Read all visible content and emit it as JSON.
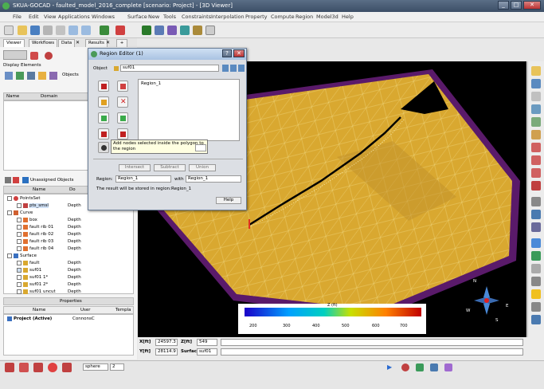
{
  "window": {
    "title": "SKUA-GOCAD - faulted_model_2016_complete  [scenario: Project]  - [3D Viewer]"
  },
  "menu": [
    "File",
    "Edit",
    "View",
    "Applications",
    "Windows",
    "Surface",
    "New",
    "Tools",
    "Constraints",
    "Interpolation",
    "Property",
    "Compute",
    "Region",
    "Model3d",
    "Help"
  ],
  "tabs": [
    "Viewer",
    "Workflows",
    "Data",
    "Results"
  ],
  "display_elements": {
    "label": "Display Elements",
    "objects_label": "Objects",
    "columns": [
      "Name",
      "Domain"
    ]
  },
  "object_tree": {
    "header": "Unassigned Objects",
    "col_name": "Name",
    "col_domain": "Do",
    "rows": [
      {
        "name": "PointsSet",
        "domain": ""
      },
      {
        "name": "pts_smsl",
        "domain": "Depth"
      },
      {
        "name": "Curve",
        "domain": ""
      },
      {
        "name": "box",
        "domain": "Depth"
      },
      {
        "name": "fault rib 01",
        "domain": "Depth"
      },
      {
        "name": "fault rib 02",
        "domain": "Depth"
      },
      {
        "name": "fault rib 03",
        "domain": "Depth"
      },
      {
        "name": "fault rib 04",
        "domain": "Depth"
      },
      {
        "name": "Surface",
        "domain": ""
      },
      {
        "name": "fault",
        "domain": "Depth"
      },
      {
        "name": "suf01",
        "domain": "Depth"
      },
      {
        "name": "suf01 1*",
        "domain": "Depth"
      },
      {
        "name": "suf01 2*",
        "domain": "Depth"
      },
      {
        "name": "suf01 uncut",
        "domain": "Depth"
      }
    ]
  },
  "properties": {
    "header": "Properties",
    "columns": [
      "Name",
      "User",
      "Templa"
    ],
    "row": {
      "name": "Project (Active)",
      "user": "ConnonsC"
    }
  },
  "dialog": {
    "title": "Region Editor (1)",
    "object_label": "Object",
    "object_value": "suf01",
    "region_list_item": "Region_1",
    "tooltip": "Add nodes selected inside the polygon to the region",
    "buttons": {
      "intersect": "Intersect",
      "subtract": "Subtract",
      "union": "Union",
      "help": "Help"
    },
    "region_label": "Region:",
    "region_value": "Region_1",
    "with_label": "with",
    "with_value": "Region_1",
    "result_text": "The result will be stored in region:",
    "result_region": "Region_1"
  },
  "colorbar": {
    "title": "Z (ft)",
    "ticks": [
      "200",
      "300",
      "400",
      "500",
      "600",
      "700"
    ]
  },
  "compass": {
    "n": "N",
    "s": "S",
    "e": "E",
    "w": "W"
  },
  "status": {
    "x_label": "X[ft]",
    "x_value": "24597.3",
    "z_label": "Z[ft]",
    "z_value": "549",
    "y_label": "Y[ft]",
    "y_value": "28114.9",
    "surface_label": "Surface",
    "surface_value": "suf01"
  },
  "bottom": {
    "shape_value": "sphere",
    "size_value": "2"
  },
  "colors": {
    "surface": "#d9a830",
    "border": "#5a1a6a",
    "background": "#000000"
  }
}
